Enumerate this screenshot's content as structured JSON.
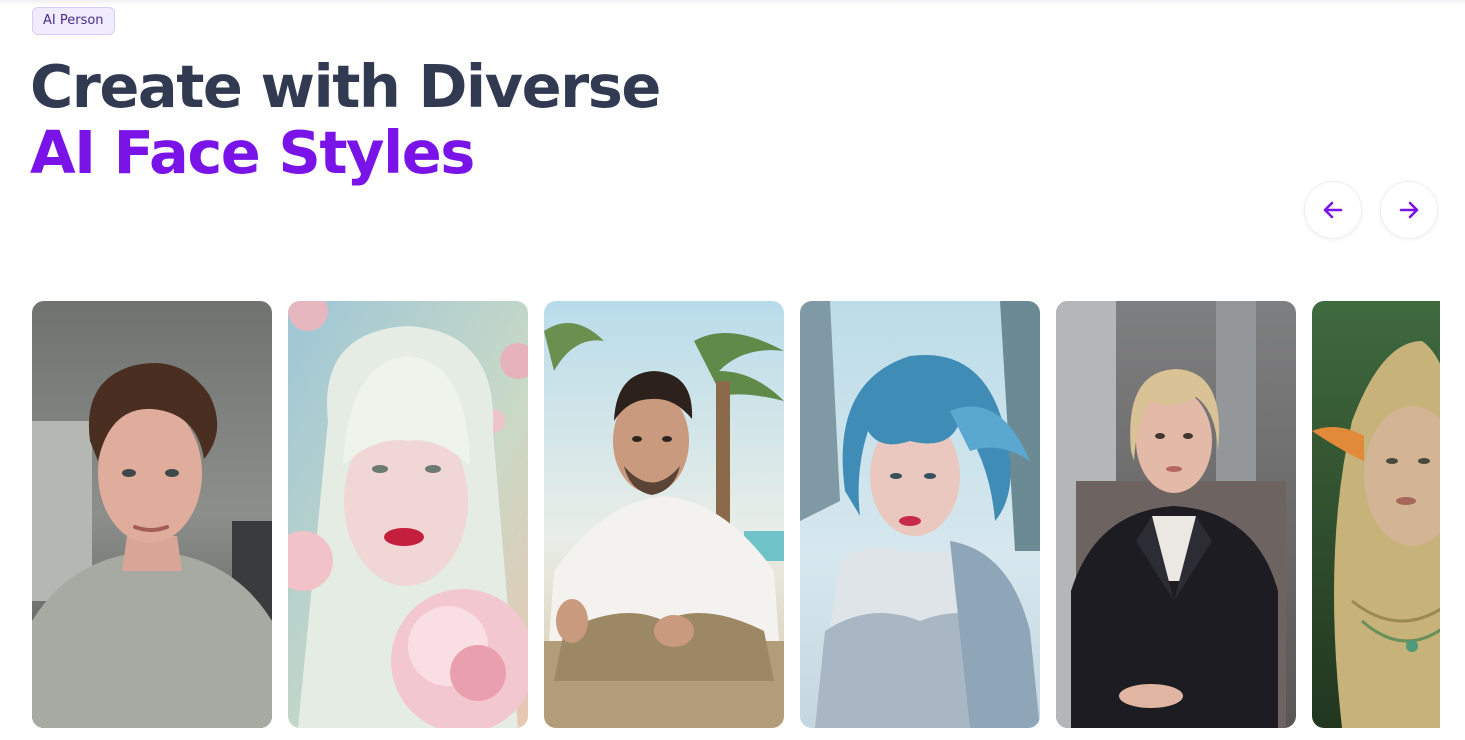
{
  "badge": {
    "label": "AI Person"
  },
  "headline": {
    "line1": "Create with Diverse",
    "line2": "AI Face Styles"
  },
  "navigation": {
    "prev_icon": "arrow-left-icon",
    "next_icon": "arrow-right-icon",
    "accent_color": "#7a13e8"
  },
  "colors": {
    "heading": "#323a52",
    "accent": "#7a13e8",
    "badge_background": "#f1ecfd",
    "badge_border": "#d9ccf6"
  },
  "gallery": {
    "cards": [
      {
        "subject": "curly-haired-man-portrait"
      },
      {
        "subject": "white-haired-woman-with-peony"
      },
      {
        "subject": "man-in-white-shirt-beach-palms"
      },
      {
        "subject": "blue-haired-woman-snow"
      },
      {
        "subject": "blonde-woman-black-blazer"
      },
      {
        "subject": "elf-with-braids-forest"
      }
    ]
  }
}
